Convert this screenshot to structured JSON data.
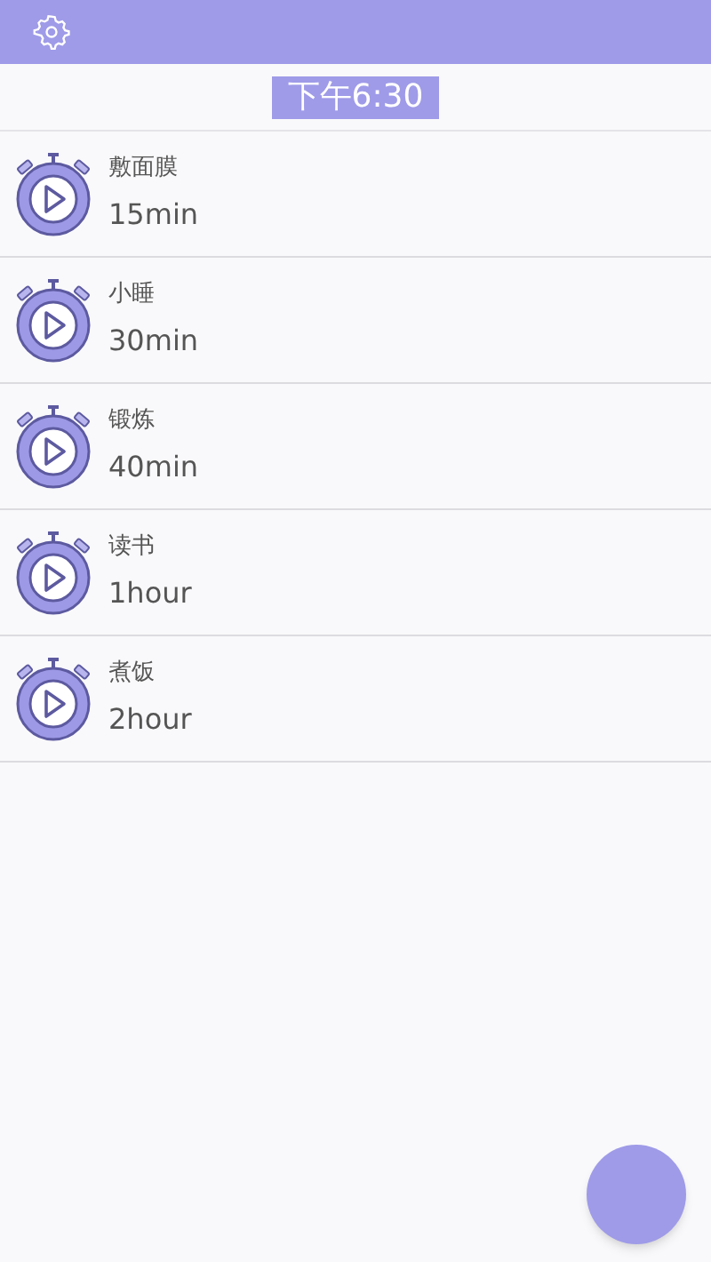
{
  "time_badge": "下午6:30",
  "timers": [
    {
      "name": "敷面膜",
      "duration": "15min"
    },
    {
      "name": "小睡",
      "duration": "30min"
    },
    {
      "name": "锻炼",
      "duration": "40min"
    },
    {
      "name": "读书",
      "duration": "1hour"
    },
    {
      "name": "煮饭",
      "duration": "2hour"
    }
  ]
}
